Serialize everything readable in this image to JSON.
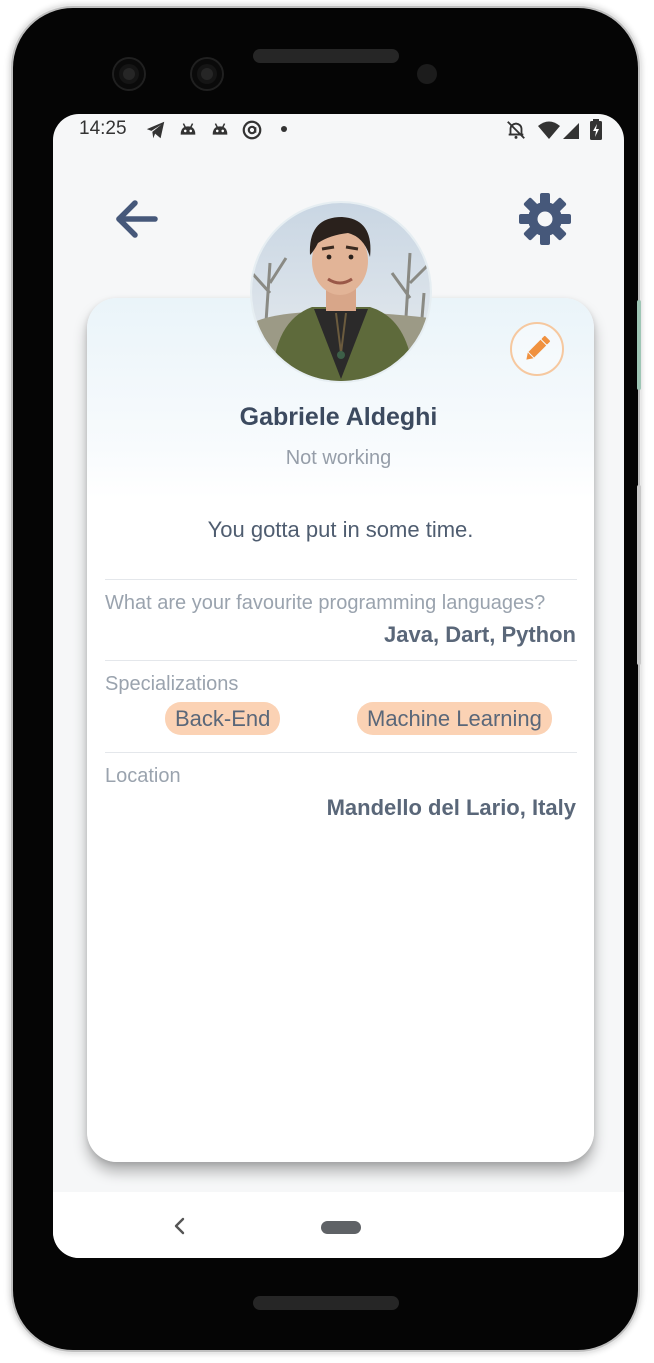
{
  "status_bar": {
    "time": "14:25",
    "icons": [
      "telegram-icon",
      "android-icon",
      "android-icon",
      "at-sign-icon",
      "dot-icon",
      "notifications-off-icon",
      "wifi-icon",
      "signal-icon",
      "battery-icon"
    ]
  },
  "top_bar": {
    "back_icon": "arrow-left-icon",
    "settings_icon": "gear-icon",
    "icon_color": "#46587a"
  },
  "profile": {
    "name": "Gabriele Aldeghi",
    "status": "Not working",
    "bio": "You gotta put in some time.",
    "avatar": "profile-photo",
    "edit_icon": "pencil-icon",
    "accent_color": "#f0913f"
  },
  "fields": [
    {
      "label": "What are your favourite programming languages?",
      "value": "Java, Dart, Python"
    },
    {
      "label": "Specializations",
      "chips": [
        "Back-End",
        "Machine Learning"
      ]
    },
    {
      "label": "Location",
      "value": "Mandello del Lario, Italy"
    }
  ],
  "colors": {
    "chip_background": "#fbd2b4",
    "text_primary": "#3c4a5f",
    "text_muted": "#9aa3ae"
  },
  "nav_bar": {
    "back_icon": "chevron-left-icon",
    "home_icon": "home-pill-icon"
  }
}
